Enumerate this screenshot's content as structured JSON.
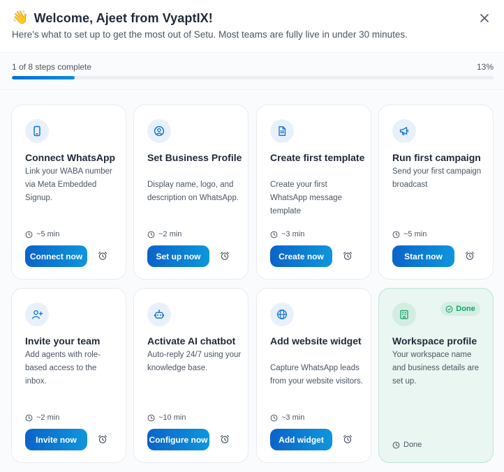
{
  "header": {
    "wave_emoji": "👋",
    "title": "Welcome, Ajeet from VyaptIX!",
    "subtitle": "Here's what to set up to get the most out of Setu. Most teams are fully live in under 30 minutes.",
    "close_icon": "close-icon"
  },
  "progress": {
    "steps_text": "1 of 8 steps complete",
    "percent_text": "13%",
    "percent_value": 13
  },
  "colors": {
    "accent": "#0b6fd1",
    "done_green": "#15a36a",
    "done_bg": "#eaf6f1"
  },
  "cards": [
    {
      "icon": "phone-icon",
      "title": "Connect WhatsApp",
      "desc": "Link your WABA number via Meta Embedded Signup.",
      "time": "~5 min",
      "button": "Connect now"
    },
    {
      "icon": "user-circle-icon",
      "title": "Set Business Profile",
      "desc": "Display name, logo, and description on WhatsApp.",
      "time": "~2 min",
      "button": "Set up now"
    },
    {
      "icon": "document-icon",
      "title": "Create first template",
      "desc": "Create your first WhatsApp message template",
      "time": "~3 min",
      "button": "Create now"
    },
    {
      "icon": "megaphone-icon",
      "title": "Run first campaign",
      "desc": "Send your first campaign broadcast",
      "time": "~5 min",
      "button": "Start now"
    },
    {
      "icon": "user-plus-icon",
      "title": "Invite your team",
      "desc": "Add agents with role-based access to the inbox.",
      "time": "~2 min",
      "button": "Invite now"
    },
    {
      "icon": "bot-icon",
      "title": "Activate AI chatbot",
      "desc": "Auto-reply 24/7 using your knowledge base.",
      "time": "~10 min",
      "button": "Configure now"
    },
    {
      "icon": "globe-icon",
      "title": "Add website widget",
      "desc": "Capture WhatsApp leads from your website visitors.",
      "time": "~3 min",
      "button": "Add widget"
    },
    {
      "icon": "building-icon",
      "title": "Workspace profile",
      "desc": "Your workspace name and business details are set up.",
      "badge": "Done",
      "status": "Done"
    }
  ]
}
